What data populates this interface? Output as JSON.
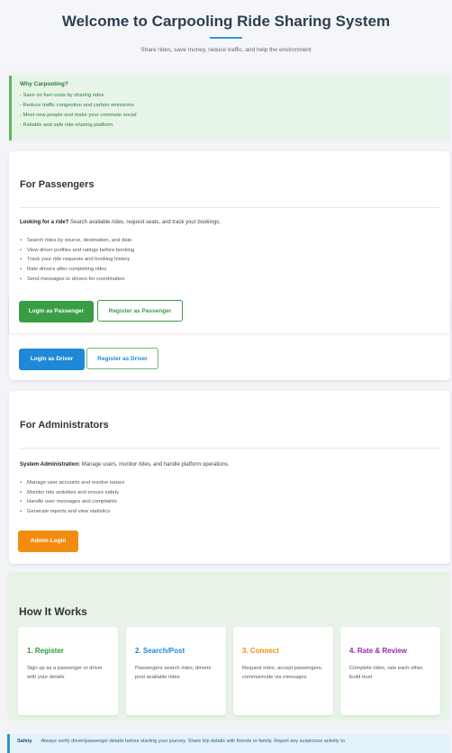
{
  "header": {
    "title": "Welcome to Carpooling Ride Sharing System",
    "subtitle": "Share rides, save money, reduce traffic, and help the environment"
  },
  "why": {
    "title": "Why Carpooling?",
    "items": [
      "- Save on fuel costs by sharing rides",
      "- Reduce traffic congestion and carbon emissions",
      "- Meet new people and make your commute social",
      "- Reliable and safe ride-sharing platform"
    ]
  },
  "passengers": {
    "title": "For Passengers",
    "intro_bold": "Looking for a ride?",
    "intro_rest": " Search available rides, request seats, and track your bookings.",
    "items": [
      "Search rides by source, destination, and date",
      "View driver profiles and ratings before booking",
      "Track your ride requests and booking history",
      "Rate drivers after completing rides",
      "Send messages to drivers for coordination"
    ],
    "login_label": "Login as Passenger",
    "register_label": "Register as Passenger"
  },
  "drivers": {
    "login_label": "Login as Driver",
    "register_label": "Register as Driver"
  },
  "admins": {
    "title": "For Administrators",
    "intro_bold": "System Administration:",
    "intro_rest": " Manage users, monitor rides, and handle platform operations.",
    "items": [
      "Manage user accounts and resolve issues",
      "Monitor ride activities and ensure safety",
      "Handle user messages and complaints",
      "Generate reports and view statistics"
    ],
    "login_label": "Admin Login"
  },
  "how": {
    "title": "How It Works",
    "steps": [
      {
        "title": "1. Register",
        "desc": "Sign up as a passenger or driver with your details",
        "color": "#2e9a3e"
      },
      {
        "title": "2. Search/Post",
        "desc": "Passengers search rides, drivers post available rides",
        "color": "#1f88d8"
      },
      {
        "title": "3. Connect",
        "desc": "Request rides, accept passengers, communicate via messages",
        "color": "#f28c0f"
      },
      {
        "title": "4. Rate & Review",
        "desc": "Complete rides, rate each other, build trust",
        "color": "#9b27af"
      }
    ]
  },
  "safety": {
    "label": "Safety",
    "text": "Always verify driver/passenger details before starting your journey. Share trip details with friends or family. Report any suspicious activity to"
  }
}
